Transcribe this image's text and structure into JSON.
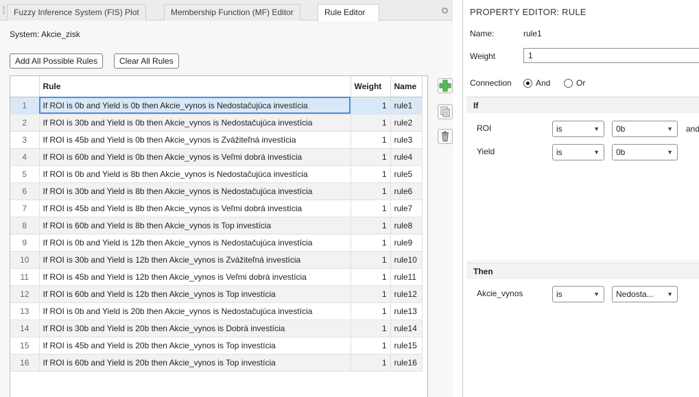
{
  "tabs": [
    {
      "label": "Fuzzy Inference System (FIS) Plot",
      "active": false
    },
    {
      "label": "Membership Function (MF) Editor",
      "active": false
    },
    {
      "label": "Rule Editor",
      "active": true
    }
  ],
  "system": {
    "label": "System: Akcie_zisk"
  },
  "buttons": {
    "add_all": "Add All Possible Rules",
    "clear_all": "Clear All Rules"
  },
  "table": {
    "columns": [
      "",
      "Rule",
      "Weight",
      "Name"
    ],
    "selected_index": 0,
    "rows": [
      {
        "index": "1",
        "rule": "If ROI is 0b and Yield is 0b then Akcie_vynos is Nedostačujúca investícia",
        "weight": "1",
        "name": "rule1"
      },
      {
        "index": "2",
        "rule": "If ROI is 30b and Yield is 0b then Akcie_vynos is Nedostačujúca investícia",
        "weight": "1",
        "name": "rule2"
      },
      {
        "index": "3",
        "rule": "If ROI is 45b and Yield is 0b then Akcie_vynos is Zvážiteľná investícia",
        "weight": "1",
        "name": "rule3"
      },
      {
        "index": "4",
        "rule": "If ROI is 60b and Yield is 0b then Akcie_vynos is Veľmi dobrá investícia",
        "weight": "1",
        "name": "rule4"
      },
      {
        "index": "5",
        "rule": "If ROI is 0b and Yield is 8b then Akcie_vynos is Nedostačujúca investícia",
        "weight": "1",
        "name": "rule5"
      },
      {
        "index": "6",
        "rule": "If ROI is 30b and Yield is 8b then Akcie_vynos is Nedostačujúca investícia",
        "weight": "1",
        "name": "rule6"
      },
      {
        "index": "7",
        "rule": "If ROI is 45b and Yield is 8b then Akcie_vynos is Veľmi dobrá investícia",
        "weight": "1",
        "name": "rule7"
      },
      {
        "index": "8",
        "rule": "If ROI is 60b and Yield is 8b then Akcie_vynos is Top investícia",
        "weight": "1",
        "name": "rule8"
      },
      {
        "index": "9",
        "rule": "If ROI is 0b and Yield is 12b then Akcie_vynos is Nedostačujúca investícia",
        "weight": "1",
        "name": "rule9"
      },
      {
        "index": "10",
        "rule": "If ROI is 30b and Yield is 12b then Akcie_vynos is Zvážiteľná investícia",
        "weight": "1",
        "name": "rule10"
      },
      {
        "index": "11",
        "rule": "If ROI is 45b and Yield is 12b then Akcie_vynos is Veľmi dobrá investícia",
        "weight": "1",
        "name": "rule11"
      },
      {
        "index": "12",
        "rule": "If ROI is 60b and Yield is 12b then Akcie_vynos is Top investícia",
        "weight": "1",
        "name": "rule12"
      },
      {
        "index": "13",
        "rule": "If ROI is 0b and Yield is 20b then Akcie_vynos is Nedostačujúca investícia",
        "weight": "1",
        "name": "rule13"
      },
      {
        "index": "14",
        "rule": "If ROI is 30b and Yield is 20b then Akcie_vynos is Dobrá investícia",
        "weight": "1",
        "name": "rule14"
      },
      {
        "index": "15",
        "rule": "If ROI is 45b and Yield is 20b then Akcie_vynos is Top investícia",
        "weight": "1",
        "name": "rule15"
      },
      {
        "index": "16",
        "rule": "If ROI is 60b and Yield is 20b then Akcie_vynos is Top investícia",
        "weight": "1",
        "name": "rule16"
      }
    ]
  },
  "side_icons": [
    "add-rule-icon",
    "copy-rule-icon",
    "delete-rule-icon"
  ],
  "property_editor": {
    "title": "PROPERTY EDITOR: RULE",
    "name_label": "Name:",
    "name_value": "rule1",
    "weight_label": "Weight",
    "weight_value": "1",
    "connection_label": "Connection",
    "connection_and": "And",
    "connection_or": "Or",
    "connection_selected": "And",
    "if_header": "If",
    "then_header": "Then",
    "if_rows": [
      {
        "var": "ROI",
        "op": "is",
        "mf": "0b",
        "connector": "and"
      },
      {
        "var": "Yield",
        "op": "is",
        "mf": "0b"
      }
    ],
    "then_rows": [
      {
        "var": "Akcie_vynos",
        "op": "is",
        "mf": "Nedosta..."
      }
    ]
  },
  "colors": {
    "selection": "#d8e8f7",
    "selection_border": "#4a90d9",
    "add_icon": "#4caf50"
  }
}
